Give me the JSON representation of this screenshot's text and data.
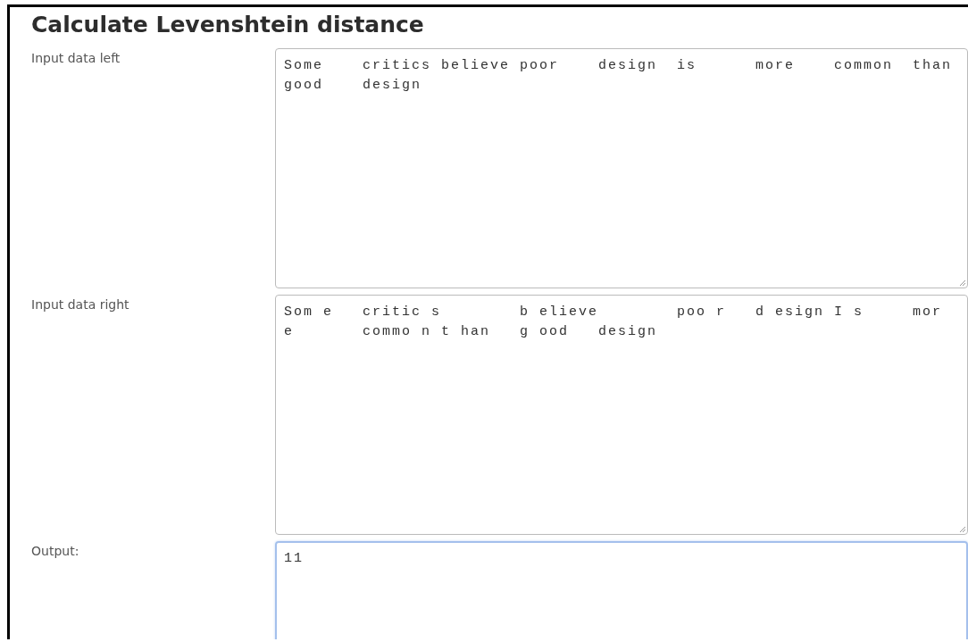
{
  "title": "Calculate Levenshtein distance",
  "fields": [
    {
      "label": "Input data left",
      "value": "Some\tcritics believe poor\tdesign\tis\tmore\tcommon\tthan\ngood\tdesign",
      "focused": false
    },
    {
      "label": "Input data right",
      "value": "Som e\tcritic s\tb elieve\tpoo r\td esign I s\tmor\ne\tcommo n t han\tg ood\tdesign",
      "focused": false
    },
    {
      "label": "Output:",
      "value": "11",
      "focused": true
    }
  ]
}
